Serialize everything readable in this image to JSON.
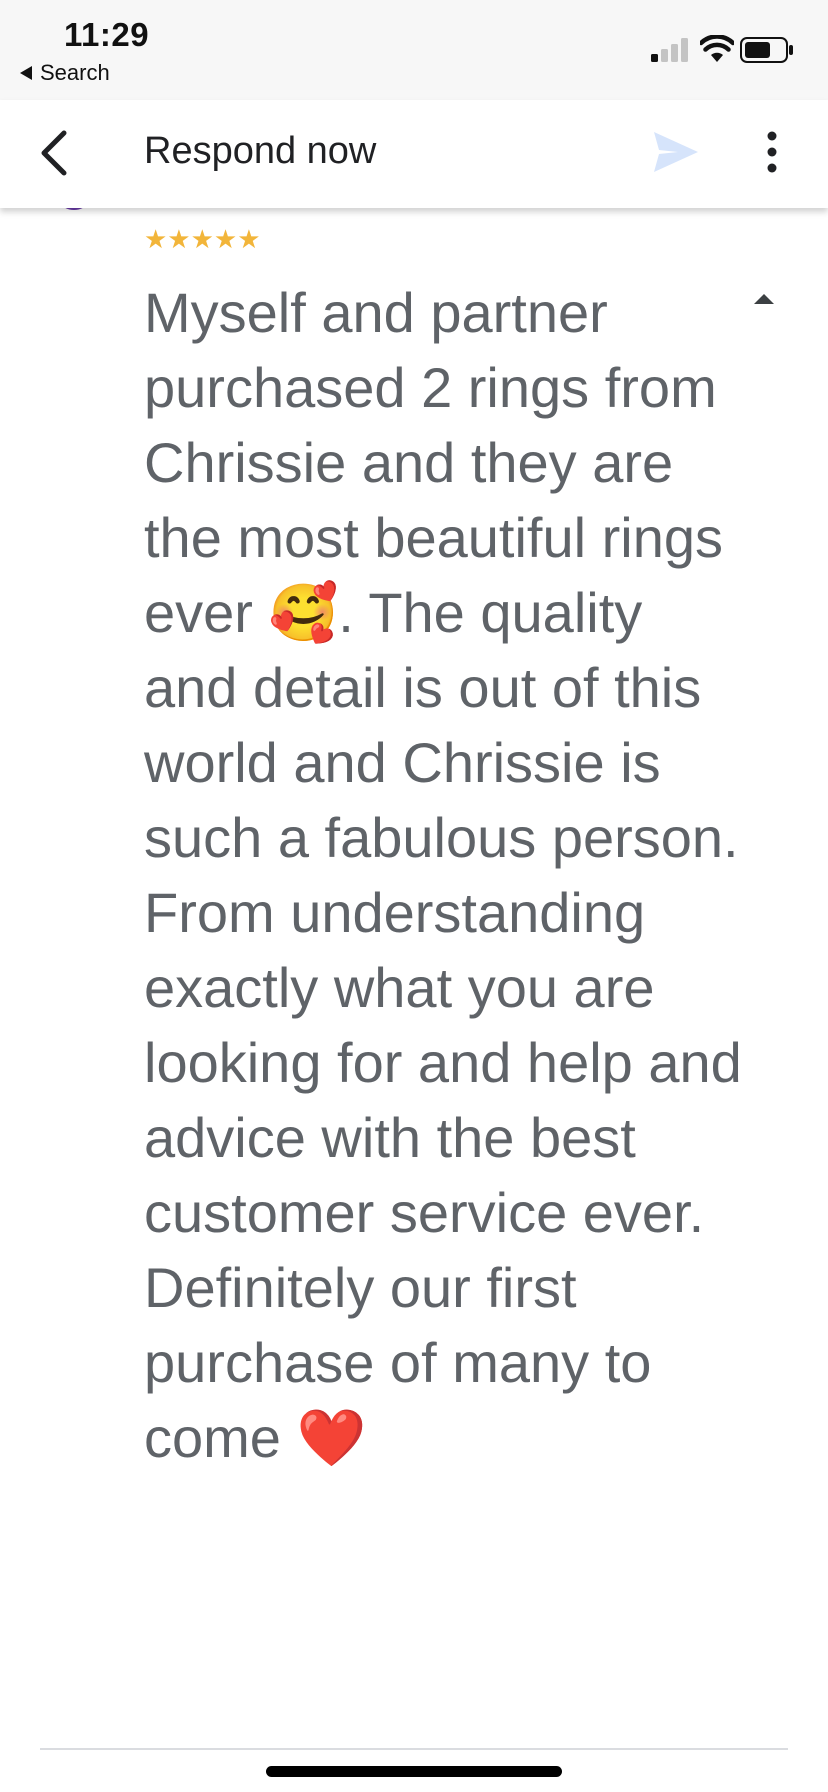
{
  "status_bar": {
    "time": "11:29",
    "back_label": "Search",
    "signal_icon": "cellular-signal-icon",
    "wifi_icon": "wifi-icon",
    "battery_icon": "battery-icon"
  },
  "app_bar": {
    "title": "Respond now",
    "back_icon": "chevron-left-icon",
    "send_icon": "send-icon",
    "more_icon": "more-vertical-icon"
  },
  "review": {
    "rating_stars": "★★★★★",
    "rating_value": 5,
    "rating_max": 5,
    "star_color": "#f2b53a",
    "text": "Myself and partner purchased 2 rings from Chrissie and they are the most beautiful rings ever 🥰. The quality and detail is out of this world and Chrissie is such a fabulous person. From understanding exactly what you are looking for and help and advice with the best customer service ever. Definitely our first purchase of many to come ❤️",
    "collapse_icon": "collapse-arrow-icon",
    "text_color": "#5f6368"
  },
  "colors": {
    "avatar": "#6a3aa8",
    "send_disabled": "#d6e4fb"
  }
}
